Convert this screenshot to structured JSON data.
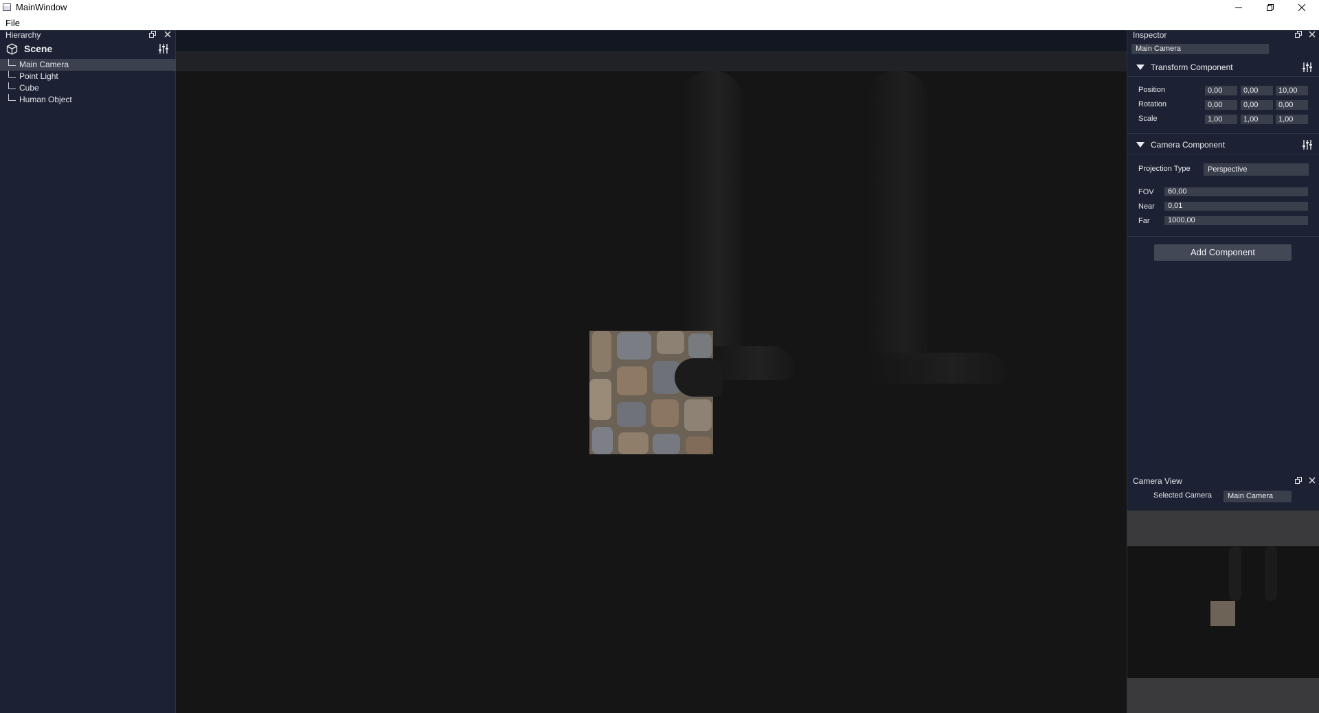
{
  "window": {
    "title": "MainWindow",
    "controls": {
      "minimize": "–",
      "restore": "❐",
      "close": "✕"
    }
  },
  "menu": {
    "items": [
      "File"
    ]
  },
  "hierarchy": {
    "title": "Hierarchy",
    "scene_label": "Scene",
    "items": [
      {
        "label": "Main Camera",
        "selected": true
      },
      {
        "label": "Point Light",
        "selected": false
      },
      {
        "label": "Cube",
        "selected": false
      },
      {
        "label": "Human Object",
        "selected": false
      }
    ]
  },
  "inspector": {
    "title": "Inspector",
    "object_name": "Main Camera",
    "transform": {
      "title": "Transform Component",
      "position_label": "Position",
      "rotation_label": "Rotation",
      "scale_label": "Scale",
      "position": [
        "0,00",
        "0,00",
        "10,00"
      ],
      "rotation": [
        "0,00",
        "0,00",
        "0,00"
      ],
      "scale": [
        "1,00",
        "1,00",
        "1,00"
      ]
    },
    "camera": {
      "title": "Camera Component",
      "projection_label": "Projection Type",
      "projection_value": "Perspective",
      "fov_label": "FOV",
      "fov_value": "60,00",
      "near_label": "Near",
      "near_value": "0,01",
      "far_label": "Far",
      "far_value": "1000,00"
    },
    "add_component_label": "Add Component"
  },
  "camera_view": {
    "title": "Camera View",
    "selected_camera_label": "Selected Camera",
    "selected_camera_value": "Main Camera"
  },
  "icons": {
    "cube": "cube-icon",
    "settings": "sliders-icon",
    "float": "float-icon",
    "close": "close-icon"
  },
  "colors": {
    "panel_bg": "#1c2233",
    "field_bg": "#3a3f4c",
    "selection_bg": "#3c4150",
    "viewport_bg": "#151515"
  }
}
